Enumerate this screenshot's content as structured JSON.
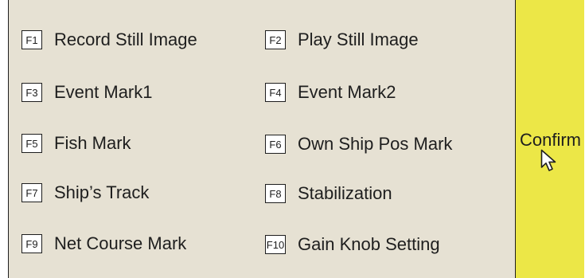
{
  "functions": [
    {
      "key": "F1",
      "label": "Record Still Image"
    },
    {
      "key": "F2",
      "label": "Play Still Image"
    },
    {
      "key": "F3",
      "label": "Event Mark1"
    },
    {
      "key": "F4",
      "label": "Event Mark2"
    },
    {
      "key": "F5",
      "label": "Fish Mark"
    },
    {
      "key": "F6",
      "label": "Own Ship Pos Mark"
    },
    {
      "key": "F7",
      "label": "Ship’s Track"
    },
    {
      "key": "F8",
      "label": "Stabilization"
    },
    {
      "key": "F9",
      "label": "Net Course Mark"
    },
    {
      "key": "F10",
      "label": "Gain Knob Setting"
    }
  ],
  "confirm": {
    "label": "Confirm"
  },
  "colors": {
    "panel": "#e6e1d3",
    "confirm": "#ece747",
    "text": "#1e1e1e"
  },
  "icons": {
    "cursor": "mouse-pointer-icon"
  }
}
